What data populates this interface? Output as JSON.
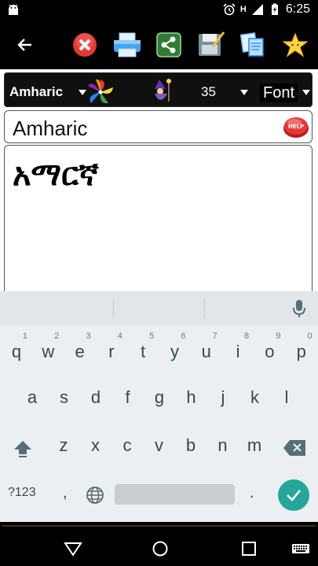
{
  "status_bar": {
    "time": "6:25",
    "network": "H"
  },
  "toolbar": {
    "back": "back-arrow-icon",
    "buttons": [
      "close-icon",
      "print-icon",
      "share-icon",
      "save-icon",
      "copy-icon",
      "favorite-star-icon"
    ]
  },
  "language_row": {
    "language": "Amharic",
    "font_size": "35",
    "font_label": "Font"
  },
  "title_field": {
    "value": "Amharic"
  },
  "editor": {
    "text": "አማርኛ"
  },
  "keyboard": {
    "row1": [
      {
        "key": "q",
        "hint": "1"
      },
      {
        "key": "w",
        "hint": "2"
      },
      {
        "key": "e",
        "hint": "3"
      },
      {
        "key": "r",
        "hint": "4"
      },
      {
        "key": "t",
        "hint": "5"
      },
      {
        "key": "y",
        "hint": "6"
      },
      {
        "key": "u",
        "hint": "7"
      },
      {
        "key": "i",
        "hint": "8"
      },
      {
        "key": "o",
        "hint": "9"
      },
      {
        "key": "p",
        "hint": "0"
      }
    ],
    "row2": [
      "a",
      "s",
      "d",
      "f",
      "g",
      "h",
      "j",
      "k",
      "l"
    ],
    "row3": [
      "z",
      "x",
      "c",
      "v",
      "b",
      "n",
      "m"
    ],
    "symbols_label": "?123",
    "comma": ",",
    "period": "."
  },
  "colors": {
    "accent_enter": "#26a69a",
    "keyboard_bg": "#eceff1"
  }
}
